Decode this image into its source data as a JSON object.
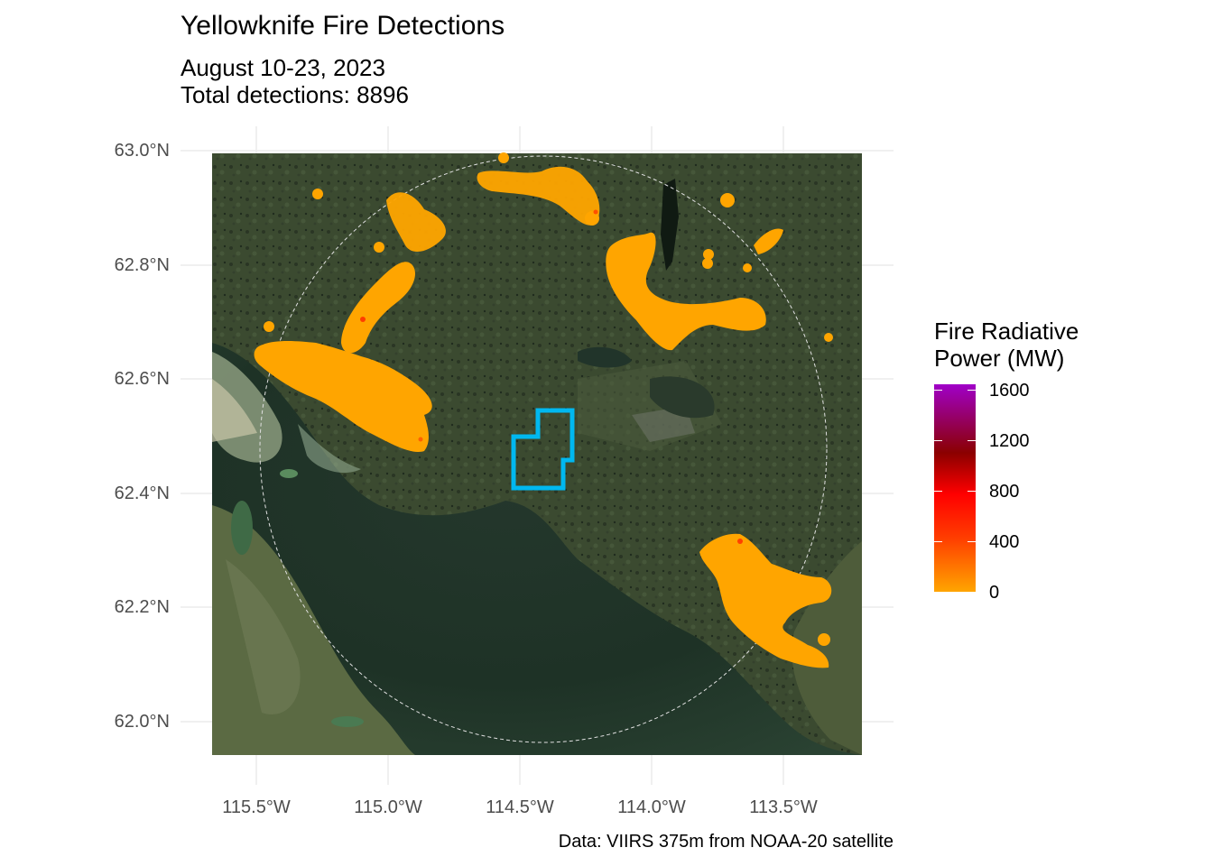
{
  "title": "Yellowknife Fire Detections",
  "subtitle_lines": [
    "August 10-23, 2023",
    "Total detections: 8896"
  ],
  "caption": "Data: VIIRS 375m from NOAA-20 satellite",
  "map": {
    "lat_ticks": [
      "63.0°N",
      "62.8°N",
      "62.6°N",
      "62.4°N",
      "62.2°N",
      "62.0°N"
    ],
    "lon_ticks": [
      "115.5°W",
      "115.0°W",
      "114.5°W",
      "114.0°W",
      "113.5°W"
    ],
    "lat_values": [
      63.0,
      62.8,
      62.6,
      62.4,
      62.2,
      62.0
    ],
    "lon_values": [
      -115.5,
      -115.0,
      -114.5,
      -114.0,
      -113.5
    ],
    "lat_range": [
      61.94,
      63.0
    ],
    "lon_range": [
      -115.67,
      -113.2
    ],
    "city_boundary_color": "#00B8F0",
    "fire_point_color": "#FFA500",
    "buffer_circle": "dashed white",
    "fire_clusters": [
      {
        "name": "northwest-arc",
        "lon": -115.05,
        "lat": 62.72
      },
      {
        "name": "west-cluster",
        "lon": -115.2,
        "lat": 62.6
      },
      {
        "name": "north-cluster",
        "lon": -114.4,
        "lat": 62.94
      },
      {
        "name": "northeast-cluster",
        "lon": -113.8,
        "lat": 62.73
      },
      {
        "name": "southeast-cluster",
        "lon": -113.6,
        "lat": 62.23
      }
    ]
  },
  "legend": {
    "title_lines": [
      "Fire Radiative",
      "Power (MW)"
    ],
    "ticks": [
      "1600",
      "1200",
      "800",
      "400",
      "0"
    ],
    "tick_values": [
      1600,
      1200,
      800,
      400,
      0
    ],
    "colors": [
      "#FFA500",
      "#FF3D00",
      "#FF0000",
      "#8B0000",
      "#A000C8"
    ]
  }
}
